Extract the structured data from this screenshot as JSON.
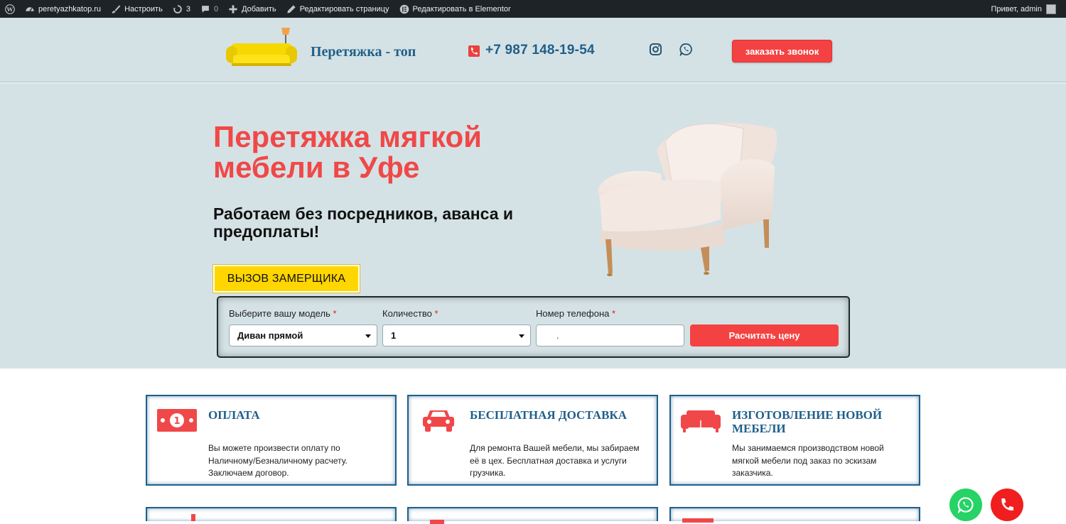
{
  "adminbar": {
    "site": "peretyazhkatop.ru",
    "customize": "Настроить",
    "updates": "3",
    "comments": "0",
    "add_new": "Добавить",
    "edit_page": "Редактировать страницу",
    "edit_elementor": "Редактировать в Elementor",
    "greeting": "Привет, admin"
  },
  "header": {
    "brand": "Перетяжка - топ",
    "phone": "+7 987 148-19-54",
    "callback_label": "заказать звонок"
  },
  "hero": {
    "title": "Перетяжка мягкой мебели в Уфе",
    "subtitle": "Работаем без посредников, аванса и предоплаты!",
    "measure_label": "ВЫЗОВ ЗАМЕРЩИКА"
  },
  "calc_form": {
    "model_label": "Выберите вашу модель",
    "model_value": "Диван прямой",
    "qty_label": "Количество",
    "qty_value": "1",
    "phone_label": "Номер телефона",
    "phone_value": ".",
    "required_mark": "*",
    "submit_label": "Расчитать цену"
  },
  "features": [
    {
      "title": "ОПЛАТА",
      "text": "Вы можете произвести оплату по Наличному/Безналичному расчету. Заключаем договор.",
      "icon": "money-icon"
    },
    {
      "title": "БЕСПЛАТНАЯ ДОСТАВКА",
      "text": "Для ремонта Вашей мебели, мы забираем её в цех. Бесплатная доставка и услуги грузчика.",
      "icon": "car-icon"
    },
    {
      "title": "ИЗГОТОВЛЕНИЕ НОВОЙ МЕБЕЛИ",
      "text": "Мы занимаемся производством новой мягкой мебели под заказ по эскизам заказчика.",
      "icon": "sofa-icon"
    }
  ],
  "colors": {
    "accent_red": "#f44242",
    "brand_blue": "#1f5f8a",
    "hero_bg": "#d5e2e5",
    "yellow": "#ffd600",
    "whatsapp_green": "#25d366"
  }
}
